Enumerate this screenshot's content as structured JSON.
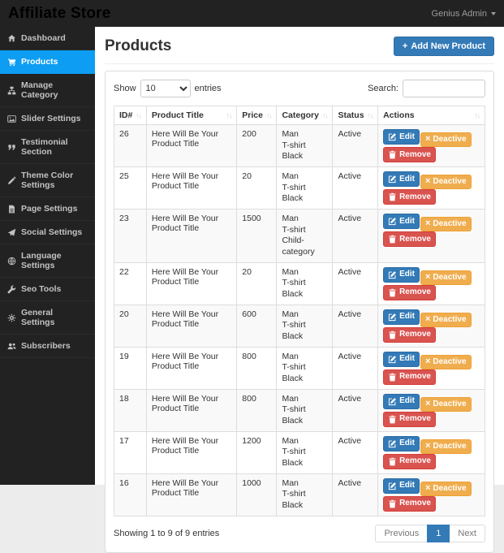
{
  "navbar": {
    "brand": "Affiliate Store",
    "user_menu_label": "Genius Admin"
  },
  "sidebar": {
    "items": [
      {
        "icon": "home-icon",
        "label": "Dashboard",
        "active": false
      },
      {
        "icon": "cart-icon",
        "label": "Products",
        "active": true
      },
      {
        "icon": "sitemap-icon",
        "label": "Manage Category",
        "active": false
      },
      {
        "icon": "image-icon",
        "label": "Slider Settings",
        "active": false
      },
      {
        "icon": "quote-icon",
        "label": "Testimonial Section",
        "active": false
      },
      {
        "icon": "pencil-icon",
        "label": "Theme Color Settings",
        "active": false
      },
      {
        "icon": "file-icon",
        "label": "Page Settings",
        "active": false
      },
      {
        "icon": "paper-plane-icon",
        "label": "Social Settings",
        "active": false
      },
      {
        "icon": "language-icon",
        "label": "Language Settings",
        "active": false
      },
      {
        "icon": "wrench-icon",
        "label": "Seo Tools",
        "active": false
      },
      {
        "icon": "gears-icon",
        "label": "General Settings",
        "active": false
      },
      {
        "icon": "users-icon",
        "label": "Subscribers",
        "active": false
      }
    ]
  },
  "page": {
    "title": "Products",
    "add_button_icon": "+",
    "add_button_label": "Add New Product"
  },
  "controls": {
    "show_label": "Show",
    "selected_page_length": "10",
    "entries_label": "entries",
    "search_label": "Search:",
    "search_value": ""
  },
  "table": {
    "columns": [
      "ID#",
      "Product Title",
      "Price",
      "Category",
      "Status",
      "Actions"
    ],
    "action_labels": {
      "edit": "Edit",
      "deactive": "Deactive",
      "remove": "Remove"
    },
    "rows": [
      {
        "id": "26",
        "title": "Here Will Be Your Product Title",
        "price": "200",
        "category_lines": [
          "Man",
          "T-shirt",
          "Black"
        ],
        "status": "Active"
      },
      {
        "id": "25",
        "title": "Here Will Be Your Product Title",
        "price": "20",
        "category_lines": [
          "Man",
          "T-shirt",
          "Black"
        ],
        "status": "Active"
      },
      {
        "id": "23",
        "title": "Here Will Be Your Product Title",
        "price": "1500",
        "category_lines": [
          "Man",
          "T-shirt",
          "Child-category"
        ],
        "status": "Active"
      },
      {
        "id": "22",
        "title": "Here Will Be Your Product Title",
        "price": "20",
        "category_lines": [
          "Man",
          "T-shirt",
          "Black"
        ],
        "status": "Active"
      },
      {
        "id": "20",
        "title": "Here Will Be Your Product Title",
        "price": "600",
        "category_lines": [
          "Man",
          "T-shirt",
          "Black"
        ],
        "status": "Active"
      },
      {
        "id": "19",
        "title": "Here Will Be Your Product Title",
        "price": "800",
        "category_lines": [
          "Man",
          "T-shirt",
          "Black"
        ],
        "status": "Active"
      },
      {
        "id": "18",
        "title": "Here Will Be Your Product Title",
        "price": "800",
        "category_lines": [
          "Man",
          "T-shirt",
          "Black"
        ],
        "status": "Active"
      },
      {
        "id": "17",
        "title": "Here Will Be Your Product Title",
        "price": "1200",
        "category_lines": [
          "Man",
          "T-shirt",
          "Black"
        ],
        "status": "Active"
      },
      {
        "id": "16",
        "title": "Here Will Be Your Product Title",
        "price": "1000",
        "category_lines": [
          "Man",
          "T-shirt",
          "Black"
        ],
        "status": "Active"
      }
    ]
  },
  "footer": {
    "info": "Showing 1 to 9 of 9 entries",
    "pagination": [
      {
        "label": "Previous",
        "active": false
      },
      {
        "label": "1",
        "active": true
      },
      {
        "label": "Next",
        "active": false
      }
    ]
  },
  "colors": {
    "navbar_bg": "#222222",
    "sidebar_bg": "#222222",
    "active_item_blue": "#0d9df2",
    "primary_blue": "#337ab7",
    "warning_orange": "#f0ad4e",
    "danger_red": "#d9534f",
    "stripe_gray": "#f9f9f9"
  }
}
